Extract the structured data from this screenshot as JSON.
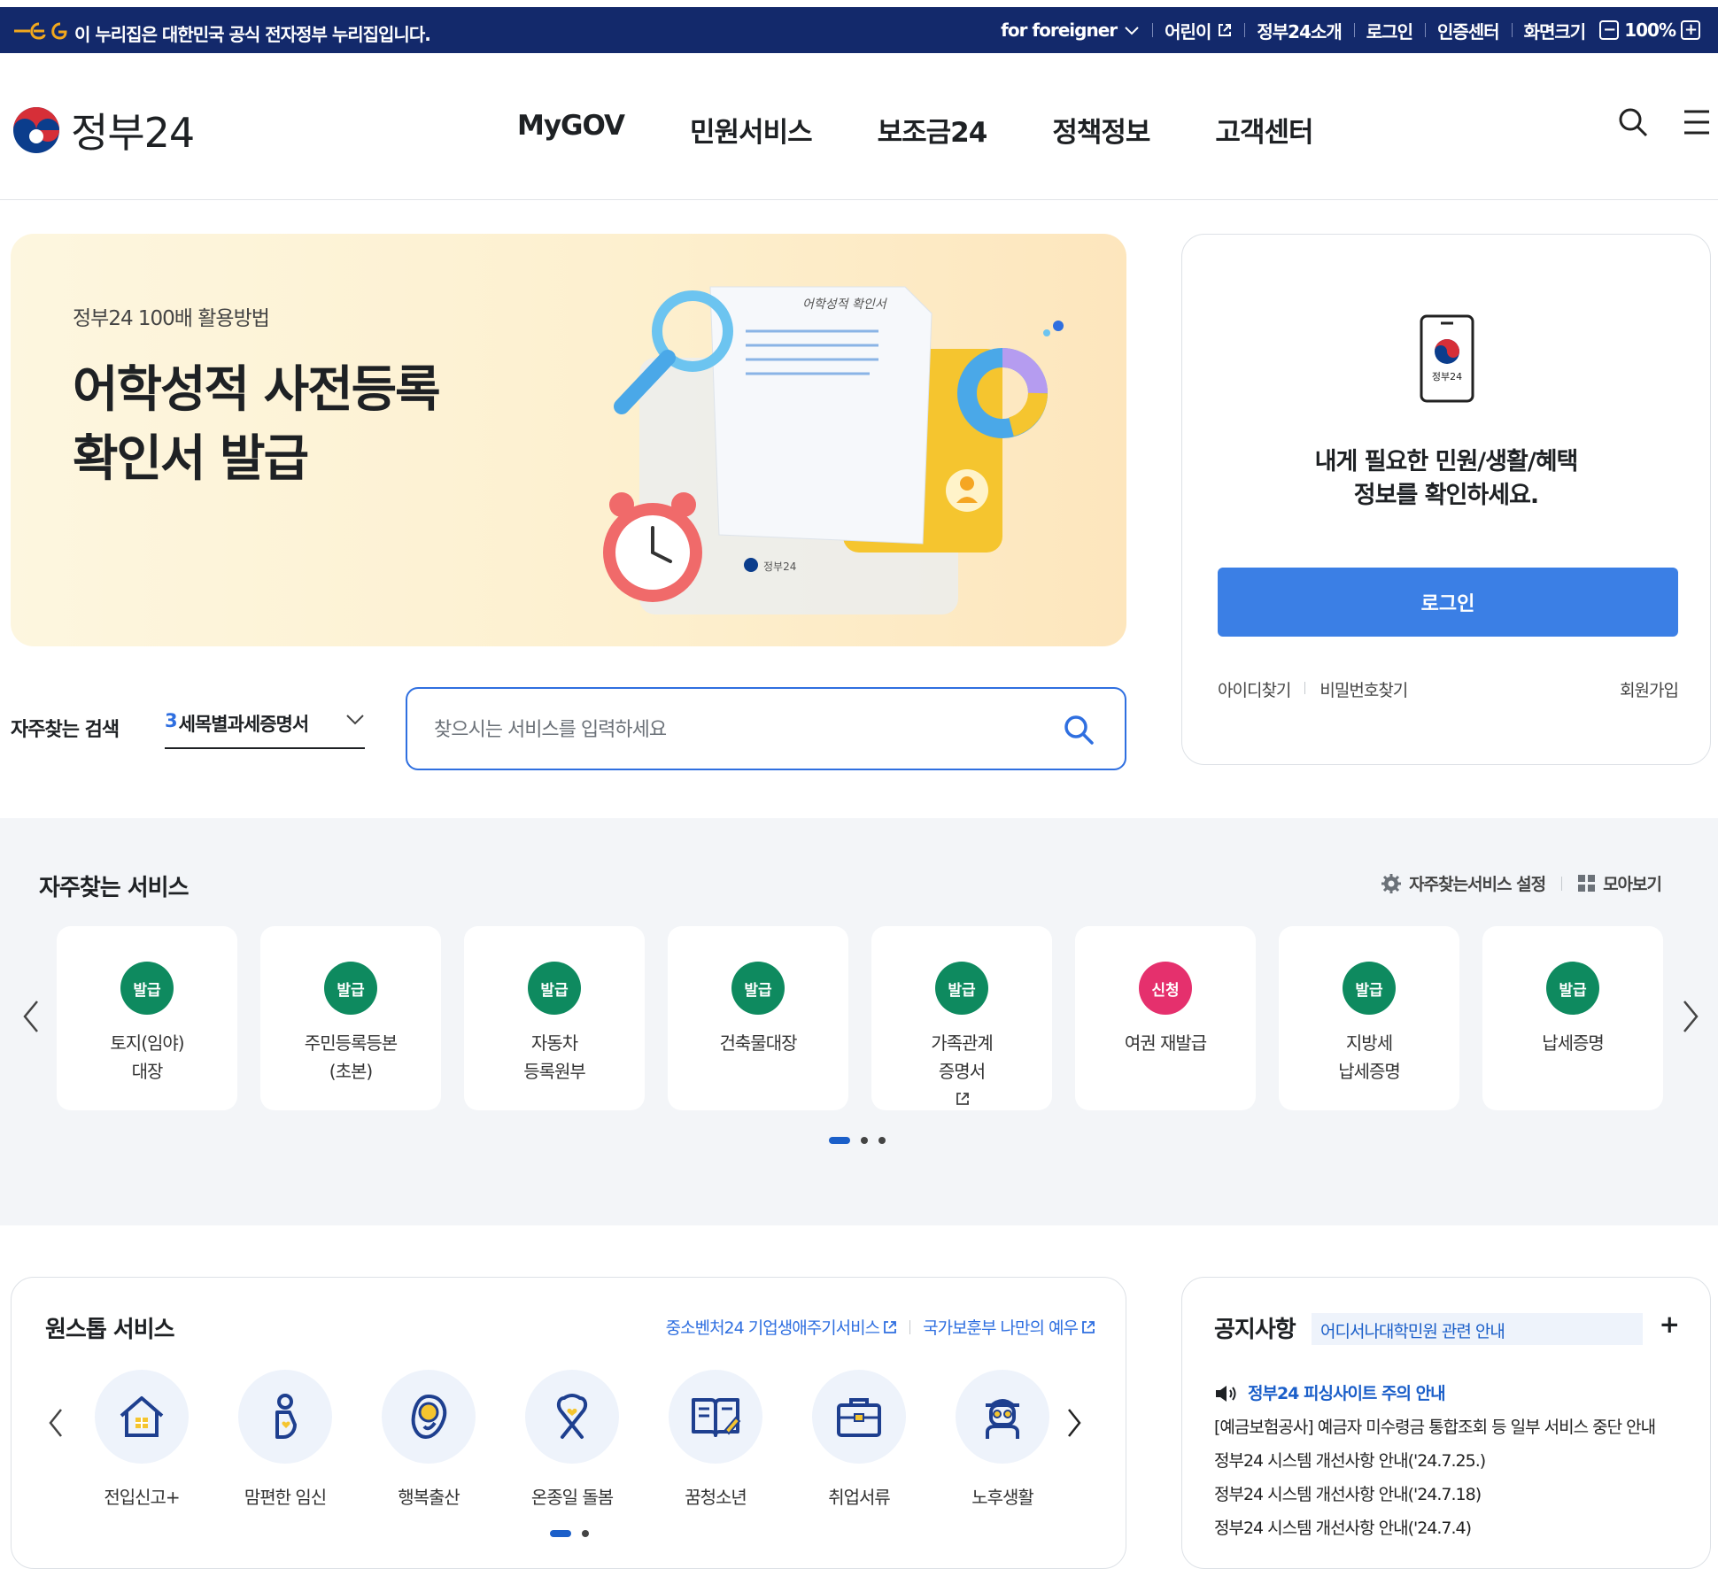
{
  "govbar": {
    "notice": "이 누리집은 대한민국 공식 전자정부 누리집입니다.",
    "for_foreigner": "for foreigner",
    "kids": "어린이",
    "about": "정부24소개",
    "login": "로그인",
    "cert": "인증센터",
    "screen_size": "화면크기",
    "zoom_minus": "−",
    "zoom_level": "100%",
    "zoom_plus": "+"
  },
  "header": {
    "logo_text": "정부24",
    "nav": [
      "MyGOV",
      "민원서비스",
      "보조금24",
      "정책정보",
      "고객센터"
    ]
  },
  "hero": {
    "kicker": "정부24 100배 활용방법",
    "title_line1": "어학성적 사전등록",
    "title_line2": "확인서 발급",
    "doc_title": "어학성적 확인서",
    "doc_brand": "정부24"
  },
  "login_card": {
    "phone_brand": "정부24",
    "message_line1": "내게 필요한 민원/생활/혜택",
    "message_line2": "정보를 확인하세요.",
    "login_button": "로그인",
    "find_id": "아이디찾기",
    "find_pw": "비밀번호찾기",
    "signup": "회원가입"
  },
  "search": {
    "freq_label": "자주찾는 검색",
    "freq_rank": "3",
    "freq_term": "세목별과세증명서",
    "placeholder": "찾으시는 서비스를 입력하세요"
  },
  "frequent_services": {
    "title": "자주찾는 서비스",
    "settings_label": "자주찾는서비스 설정",
    "view_all_label": "모아보기",
    "items": [
      {
        "badge": "발급",
        "line1": "토지(임야)",
        "line2": "대장"
      },
      {
        "badge": "발급",
        "line1": "주민등록등본",
        "line2": "(초본)"
      },
      {
        "badge": "발급",
        "line1": "자동차",
        "line2": "등록원부"
      },
      {
        "badge": "발급",
        "line1": "건축물대장",
        "line2": ""
      },
      {
        "badge": "발급",
        "line1": "가족관계",
        "line2": "증명서"
      },
      {
        "badge": "신청",
        "line1": "여권 재발급",
        "line2": ""
      },
      {
        "badge": "발급",
        "line1": "지방세",
        "line2": "납세증명"
      },
      {
        "badge": "발급",
        "line1": "납세증명",
        "line2": ""
      }
    ],
    "pages": 3,
    "current_page": 1
  },
  "onestop": {
    "title": "원스톱 서비스",
    "link1": "중소벤처24 기업생애주기서비스",
    "link2": "국가보훈부 나만의 예우",
    "items": [
      "전입신고+",
      "맘편한 임신",
      "행복출산",
      "온종일 돌봄",
      "꿈청소년",
      "취업서류",
      "노후생활"
    ],
    "pages": 2,
    "current_page": 1
  },
  "notices": {
    "title": "공지사항",
    "tag": "어디서나대학민원 관련 안내",
    "more": "+",
    "highlight": "정부24 피싱사이트 주의 안내",
    "items": [
      "[예금보험공사] 예금자 미수령금 통합조회 등 일부 서비스 중단 안내",
      "정부24 시스템 개선사항 안내('24.7.25.)",
      "정부24 시스템 개선사항 안내('24.7.18)",
      "정부24 시스템 개선사항 안내('24.7.4)"
    ]
  },
  "colors": {
    "govbar_bg": "#13296b",
    "primary_blue": "#3b7fe5",
    "badge_green": "#0e8a5f",
    "badge_red": "#e5306d"
  }
}
